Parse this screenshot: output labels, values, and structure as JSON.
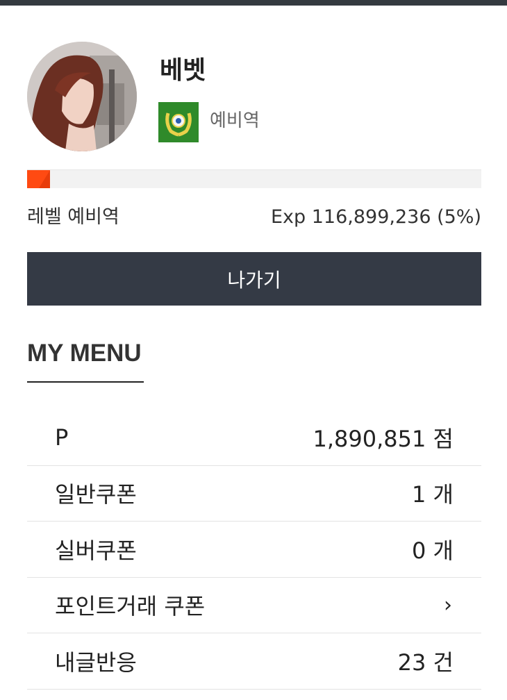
{
  "profile": {
    "nickname": "베벳",
    "rank_name": "예비역"
  },
  "level": {
    "label": "레벨 예비역",
    "exp_text": "Exp 116,899,236 (5%)",
    "exp_percent": 5
  },
  "logout_button": "나가기",
  "section_title": "MY MENU",
  "menu": [
    {
      "label": "P",
      "value": "1,890,851 점"
    },
    {
      "label": "일반쿠폰",
      "value": "1 개"
    },
    {
      "label": "실버쿠폰",
      "value": "0 개"
    },
    {
      "label": "포인트거래 쿠폰",
      "value": "›",
      "icon": "chevron-right-icon"
    },
    {
      "label": "내글반응",
      "value": "23 건"
    }
  ],
  "colors": {
    "topbar": "#343a40",
    "button_bg": "#343a45",
    "exp_fill": "#ff4a12",
    "badge_green": "#2f8a2a"
  }
}
